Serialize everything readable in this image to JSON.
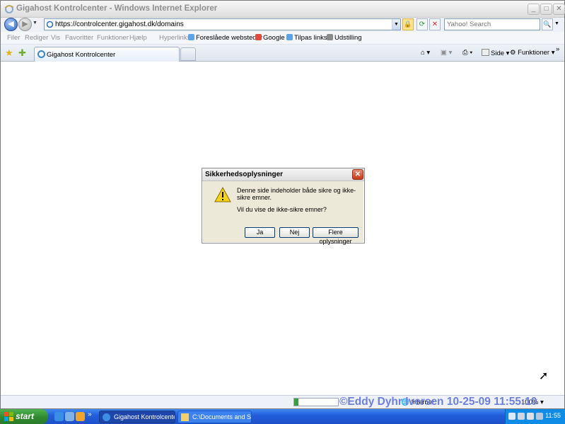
{
  "window": {
    "title": "Gigahost Kontrolcenter - Windows Internet Explorer",
    "min_label": "_",
    "max_label": "□",
    "close_label": "✕"
  },
  "address": {
    "url": "https://controlcenter.gigahost.dk/domains",
    "search_placeholder": "Yahoo! Search"
  },
  "menu": [
    "Filer",
    "Rediger",
    "Vis",
    "Favoritter",
    "Funktioner",
    "Hjælp"
  ],
  "links": {
    "label": "Hyperlinks",
    "items": [
      "Foreslåede websteder",
      "Google",
      "Tilpas links",
      "Udstilling"
    ]
  },
  "tab": {
    "label": "Gigahost Kontrolcenter"
  },
  "commands": {
    "page": "Side",
    "tools": "Funktioner"
  },
  "dialog": {
    "title": "Sikkerhedsoplysninger",
    "message": "Denne side indeholder både sikre og ikke-sikre emner.",
    "question": "Vil du vise de ikke-sikre emner?",
    "yes": "Ja",
    "no": "Nej",
    "more": "Flere oplysninger",
    "close": "✕"
  },
  "status": {
    "zone": "Internet",
    "zoom": "100%",
    "progress": 0.1
  },
  "watermark": "©Eddy Dyhr Iversen 10-25-09 11:55:10",
  "taskbar": {
    "start": "start",
    "tasks": [
      "Gigahost Kontrolcenter...",
      "C:\\Documents and Se..."
    ],
    "clock": "11:55"
  }
}
